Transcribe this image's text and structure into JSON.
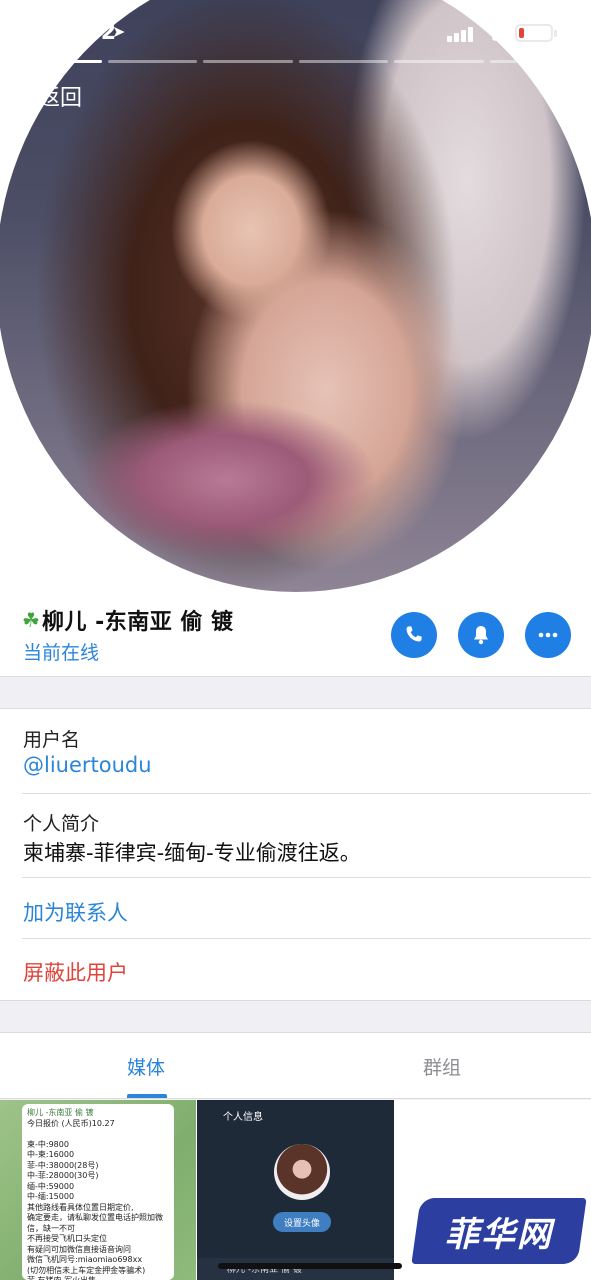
{
  "status_bar": {
    "time": "12:42",
    "battery_level": 0.15,
    "battery_color": "#e0443a"
  },
  "navigation": {
    "back_label": "返回",
    "story_count": 6,
    "active_story": 1
  },
  "profile": {
    "name": "柳儿 -东南亚 偷 镀",
    "name_icon": "clover-icon",
    "status": "当前在线",
    "actions": [
      "phone-icon",
      "bell-icon",
      "more-icon"
    ]
  },
  "info": {
    "username_label": "用户名",
    "username_value": "@liuertoudu",
    "bio_label": "个人简介",
    "bio_value": "柬埔寨-菲律宾-缅甸-专业偷渡往返。",
    "add_contact": "加为联系人",
    "block_user": "屏蔽此用户"
  },
  "tabs": {
    "media": "媒体",
    "groups": "群组",
    "active": "media"
  },
  "media_thumbnails": {
    "thumb1": {
      "header": "柳儿 -东南亚 偷 镀",
      "lines": [
        "今日报价 (人民币)10.27",
        "",
        "柬-中:9800",
        "中-柬:16000",
        "菲-中:38000(28号)",
        "中-菲:28000(30号)",
        "缅-中:59000",
        "中-缅:15000",
        "其他路线看具体位置日期定价,",
        "确定要走，请私聊发位置电话护照加微",
        "信，缺一不可",
        "不再接受飞机口头定位",
        "有疑问可加微信直接语音询问",
        "微信飞机同号:miaomiao698xx",
        "(切勿相信未上车定金押金等骗术)",
        "菲 有猪肉 军火出售"
      ]
    },
    "thumb2": {
      "title": "个人信息",
      "button": "设置头像",
      "footer": "柳儿 -东南亚 偷 镀"
    }
  },
  "watermark": "菲华网",
  "colors": {
    "accent_blue": "#2b86d9",
    "button_blue": "#1f7fe5",
    "danger_red": "#e0443a",
    "background_gray": "#efeff4"
  }
}
